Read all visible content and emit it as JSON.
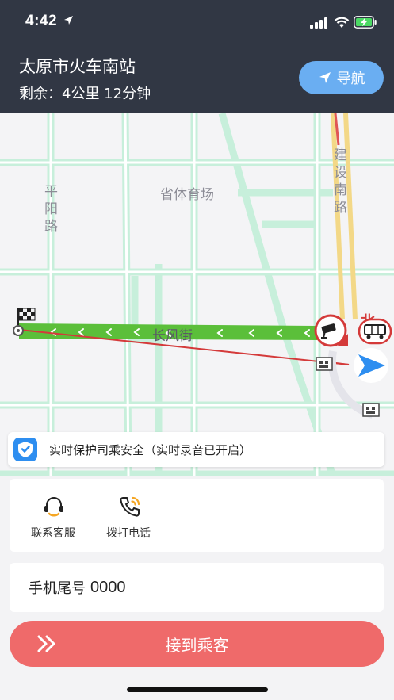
{
  "status_bar": {
    "time": "4:42",
    "icons": [
      "location-arrow-icon",
      "signal-icon",
      "wifi-icon",
      "battery-charging-icon"
    ]
  },
  "header": {
    "destination": "太原市火车南站",
    "remaining": "剩余：4公里  12分钟",
    "nav_button_label": "导航",
    "nav_button_icon": "navigation-arrow-icon"
  },
  "map": {
    "labels": {
      "pingyang_road": "平阳路",
      "jianshe_south_road": "建设南路",
      "provincial_stadium": "省体育场",
      "changfeng_street": "长风街",
      "north_badge": "北"
    },
    "route_color": "#5bbf3a",
    "background_road_color": "#c7efdb",
    "icons": [
      "finish-flag-icon",
      "traffic-camera-icon",
      "bus-icon",
      "current-location-arrow-icon"
    ]
  },
  "safety_notice": {
    "icon": "shield-icon",
    "text": "实时保护司乘安全（实时录音已开启）"
  },
  "actions": [
    {
      "icon": "headset-icon",
      "label": "联系客服"
    },
    {
      "icon": "phone-call-icon",
      "label": "拨打电话"
    }
  ],
  "phone_tail": {
    "label": "手机尾号",
    "value": "0000"
  },
  "pickup_button": {
    "label": "接到乘客",
    "icon": "double-chevron-right-icon",
    "color": "#ef6a6a"
  },
  "colors": {
    "header_bg": "#313744",
    "nav_button": "#6aaef2",
    "accent_blue": "#2e8ef0"
  }
}
